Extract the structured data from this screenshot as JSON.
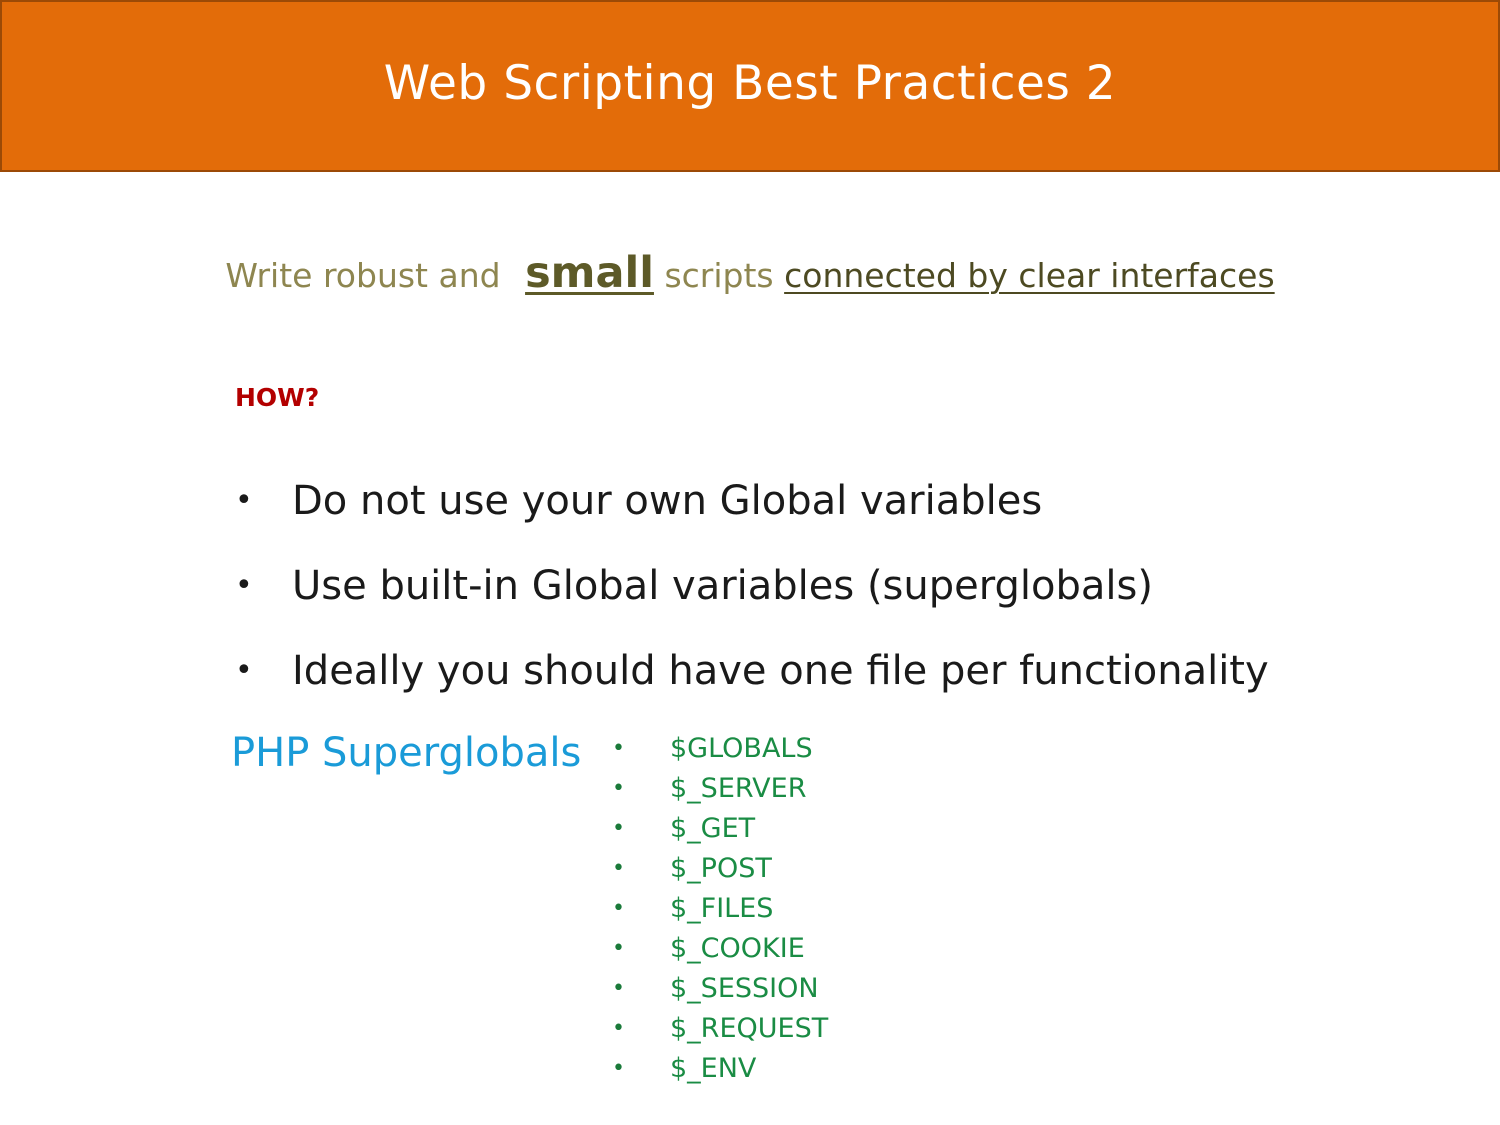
{
  "slide": {
    "title": "Web Scripting Best Practices 2",
    "subtitle": {
      "part1": "Write  robust and",
      "emphasis": "small",
      "part2": "scripts",
      "link": "connected by clear interfaces"
    },
    "how_label": "HOW?",
    "bullet_glyph": "•",
    "bullets": [
      "Do not use your own Global variables",
      "Use built-in Global variables (superglobals)",
      "Ideally you should have one file per functionality"
    ],
    "superglobals_label": "PHP Superglobals",
    "superglobals": [
      "$GLOBALS",
      "$_SERVER",
      "$_GET",
      "$_POST",
      "$_FILES",
      "$_COOKIE",
      "$_SESSION",
      "$_REQUEST",
      "$_ENV"
    ]
  },
  "colors": {
    "title_bar": "#e36c09",
    "how": "#b30000",
    "php_label": "#1a9bd8",
    "superglobals": "#1a8c44"
  }
}
